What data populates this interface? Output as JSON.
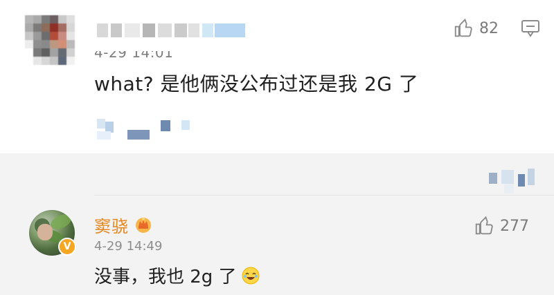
{
  "top_comment": {
    "timestamp": "4-29 14:01",
    "text": "what? 是他俩没公布过还是我 2G 了",
    "like_count": "82"
  },
  "reply": {
    "username": "窦骁",
    "timestamp": "4-29 14:49",
    "text": "没事，我也 2g 了",
    "like_count": "277",
    "verified_mark": "V"
  },
  "colors": {
    "username_color": "#e5871f",
    "text_color": "#202020",
    "meta_gray": "#8d8d8d",
    "icon_gray": "#7b7b7b",
    "reply_bg": "#f3f3f3",
    "verified_bg": "#f5a623"
  },
  "icons": {
    "like": "thumbs-up-icon",
    "reply": "comment-bubble-icon",
    "crown": "crown-icon",
    "emoji": "laughing-emoji-icon"
  }
}
